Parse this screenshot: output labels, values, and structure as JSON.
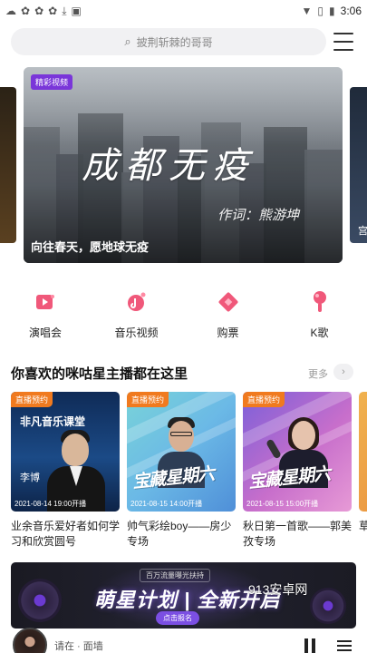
{
  "status_bar": {
    "time": "3:06"
  },
  "search": {
    "placeholder": "披荆斩棘的哥哥"
  },
  "banner": {
    "tag": "精彩视频",
    "title": "成都无疫",
    "credit": "作词：熊游坤",
    "caption": "向往春天，愿地球无疫",
    "peek_right_text": "宫"
  },
  "quick_menu": [
    {
      "label": "演唱会",
      "icon": "concert-icon"
    },
    {
      "label": "音乐视频",
      "icon": "music-video-icon"
    },
    {
      "label": "购票",
      "icon": "ticket-icon"
    },
    {
      "label": "K歌",
      "icon": "microphone-icon"
    }
  ],
  "section": {
    "title": "你喜欢的咪咕星主播都在这里",
    "more": "更多"
  },
  "cards": [
    {
      "badge": "直播预约",
      "date": "2021-08-14 19:00开播",
      "title": "业余音乐爱好者如何学习和欣赏圆号",
      "brand": "非凡音乐课堂",
      "name": "李博"
    },
    {
      "badge": "直播预约",
      "date": "2021-08-15 14:00开播",
      "title": "帅气彩绘boy——房少专场",
      "brush": "宝藏星期六"
    },
    {
      "badge": "直播预约",
      "date": "2021-08-15 15:00开播",
      "title": "秋日第一首歌——郭美孜专场",
      "brush": "宝藏星期六"
    },
    {
      "title": "草"
    }
  ],
  "promo": {
    "top": "百万流量曝光扶持",
    "main": "萌星计划 | 全新开启",
    "button": "点击报名"
  },
  "watermark": "913安卓网",
  "player": {
    "song": "请在 · 面墙"
  }
}
